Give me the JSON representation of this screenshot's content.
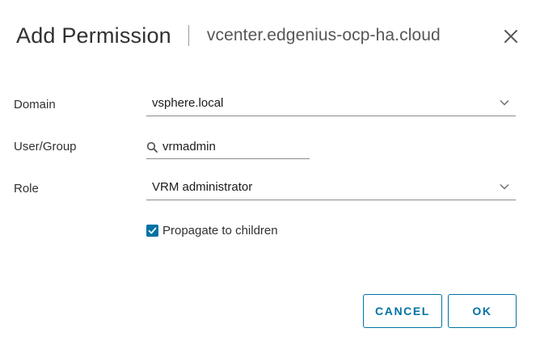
{
  "dialog": {
    "title": "Add Permission",
    "subtitle": "vcenter.edgenius-ocp-ha.cloud",
    "close_icon": "close-icon"
  },
  "form": {
    "domain": {
      "label": "Domain",
      "value": "vsphere.local"
    },
    "user_group": {
      "label": "User/Group",
      "value": "vrmadmin",
      "icon": "search-icon"
    },
    "role": {
      "label": "Role",
      "value": "VRM administrator"
    },
    "propagate": {
      "label": "Propagate to children",
      "checked": true
    }
  },
  "buttons": {
    "cancel": "CANCEL",
    "ok": "OK"
  },
  "colors": {
    "accent": "#0072a3",
    "text": "#313131",
    "underline": "#8c8c8c"
  }
}
